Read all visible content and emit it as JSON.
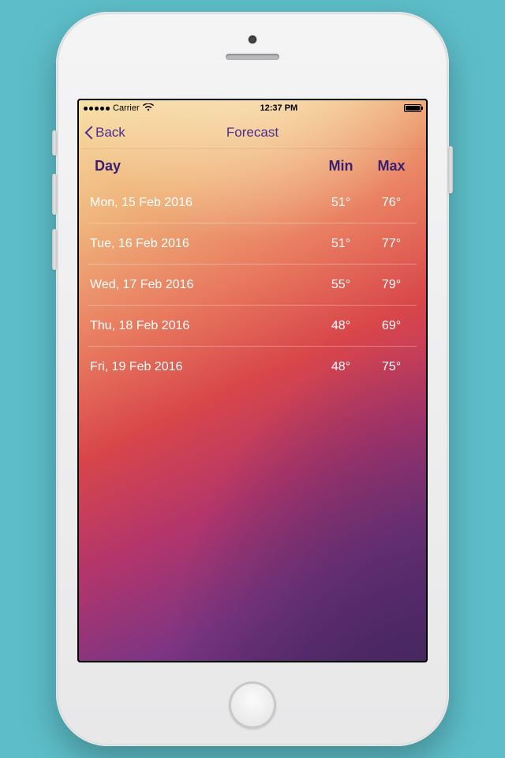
{
  "statusbar": {
    "carrier": "Carrier",
    "time": "12:37 PM"
  },
  "navbar": {
    "back_label": "Back",
    "title": "Forecast"
  },
  "columns": {
    "day": "Day",
    "min": "Min",
    "max": "Max"
  },
  "forecast": [
    {
      "day": "Mon, 15 Feb 2016",
      "min": "51°",
      "max": "76°"
    },
    {
      "day": "Tue, 16 Feb 2016",
      "min": "51°",
      "max": "77°"
    },
    {
      "day": "Wed, 17 Feb 2016",
      "min": "55°",
      "max": "79°"
    },
    {
      "day": "Thu, 18 Feb 2016",
      "min": "48°",
      "max": "69°"
    },
    {
      "day": "Fri, 19 Feb 2016",
      "min": "48°",
      "max": "75°"
    }
  ]
}
